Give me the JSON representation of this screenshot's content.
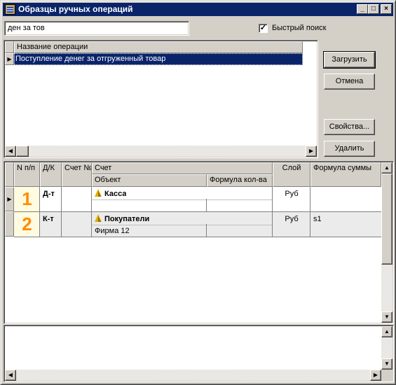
{
  "window": {
    "title": "Образцы ручных операций",
    "controls": {
      "minimize": "_",
      "maximize": "□",
      "close": "×"
    }
  },
  "search": {
    "value": "ден за тов",
    "quick_search_label": "Быстрый поиск",
    "quick_search_checked": true
  },
  "operations": {
    "column": "Название операции",
    "rows": [
      "Поступление денег за отгруженный товар"
    ],
    "selected_index": 0
  },
  "buttons": {
    "load": "Загрузить",
    "cancel": "Отмена",
    "properties": "Свойства...",
    "delete": "Удалить"
  },
  "entries": {
    "headers": {
      "num": "N п/п",
      "dk": "Д/К",
      "account_no": "Счет №",
      "account": "Счет",
      "object": "Объект",
      "qty_formula": "Формула кол-ва",
      "layer": "Слой",
      "sum_formula": "Формула суммы"
    },
    "rows": [
      {
        "num": "1",
        "dk": "Д-т",
        "account_no": "",
        "account": "Касса",
        "object": "",
        "qty_formula": "",
        "layer": "Руб",
        "sum_formula": ""
      },
      {
        "num": "2",
        "dk": "К-т",
        "account_no": "",
        "account": "Покупатели",
        "object": "Фирма 12",
        "qty_formula": "",
        "layer": "Руб",
        "sum_formula": "s1"
      }
    ]
  },
  "notes": {
    "text": ""
  },
  "icons": {
    "window": "app-window-icon",
    "account": "pyramid-account-icon",
    "row_pointer": "row-pointer-arrow-icon"
  },
  "colors": {
    "titlebar": "#0a246a",
    "selection": "#0a246a",
    "row_number": "#ff8c00",
    "face": "#d4d0c8"
  }
}
